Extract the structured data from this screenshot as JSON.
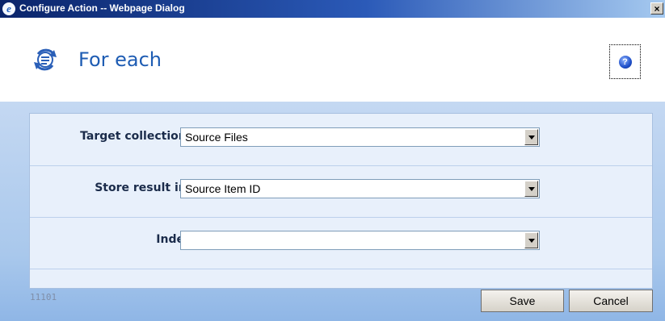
{
  "window": {
    "title": "Configure Action -- Webpage Dialog",
    "app_icon": "ie-icon",
    "close_label": "×"
  },
  "header": {
    "title": "For each",
    "icon": "loop-icon",
    "help_icon": "help-icon",
    "help_glyph": "?"
  },
  "form": {
    "target_collection": {
      "label": "Target collection",
      "required_mark": "*",
      "value": "Source Files"
    },
    "store_result": {
      "label": "Store result in",
      "required_mark": "*",
      "value": "Source Item ID"
    },
    "index": {
      "label": "Index",
      "value": ""
    }
  },
  "footer": {
    "code": "11101",
    "save_label": "Save",
    "cancel_label": "Cancel"
  },
  "colors": {
    "titlebar_start": "#0a246a",
    "title_text": "#1e5cb3",
    "required": "#cc2222",
    "panel_bg": "#e8f0fb"
  }
}
